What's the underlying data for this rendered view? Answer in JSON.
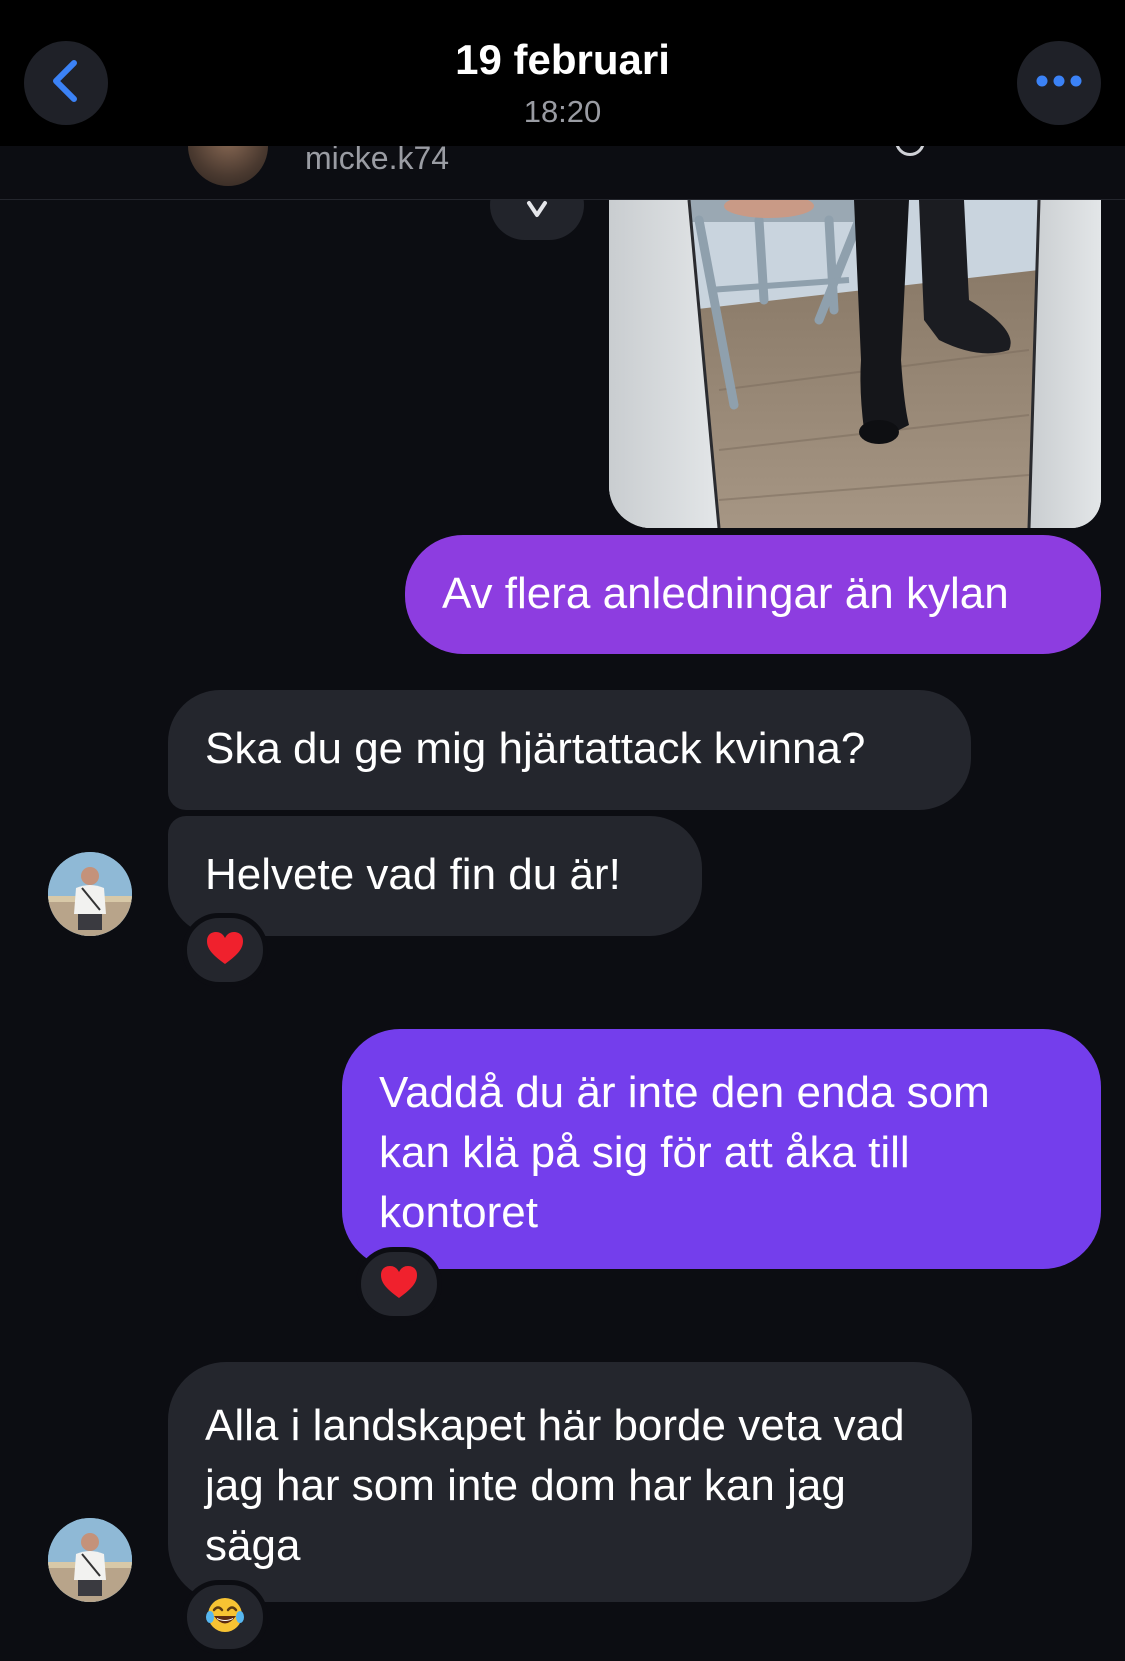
{
  "header": {
    "date": "19 februari",
    "time": "18:20",
    "back_icon": "chevron-left-icon",
    "more_icon": "ellipsis-icon"
  },
  "subheader": {
    "username": "micke.k74"
  },
  "colors": {
    "outgoing_bubble_1": "#8d3de0",
    "outgoing_bubble_2": "#743eec",
    "incoming_bubble": "#24262d",
    "accent_blue": "#3b82f6",
    "background": "#0c0d12"
  },
  "messages": [
    {
      "direction": "outgoing",
      "type": "image",
      "description_icon": "photo-attachment"
    },
    {
      "direction": "outgoing",
      "text": "Av flera anledningar än kylan"
    },
    {
      "direction": "incoming",
      "text": "Ska du ge mig hjärtattack kvinna?"
    },
    {
      "direction": "incoming",
      "text": "Helvete vad fin du är!",
      "reaction": "red-heart"
    },
    {
      "direction": "outgoing",
      "text": "Vaddå du är inte den enda som kan klä på sig för att åka till kontoret",
      "reaction": "red-heart"
    },
    {
      "direction": "incoming",
      "text": "Alla i landskapet här borde veta vad jag har som inte dom har kan jag säga",
      "reaction": "laughing-tears",
      "reaction_char": "😂"
    }
  ]
}
